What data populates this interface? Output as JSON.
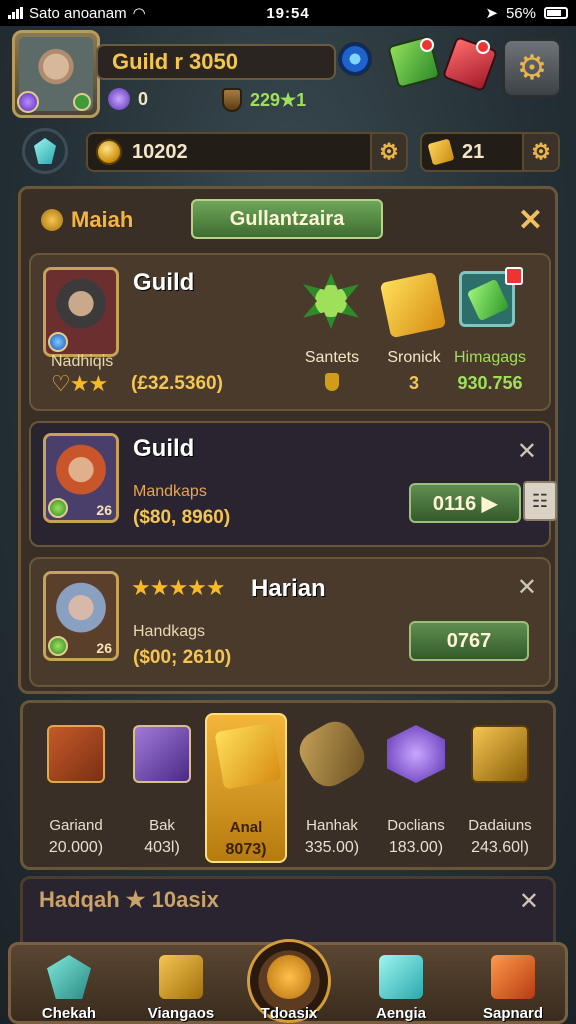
{
  "status": {
    "carrier": "Sato anoanam",
    "time": "19:54",
    "battery": "56%"
  },
  "header": {
    "title": "Guild r 3050",
    "purple_count": "0",
    "green_count": "229★1"
  },
  "resources": {
    "coins": "10202",
    "gold": "21"
  },
  "panel": {
    "title": "Maiah",
    "tab": "Gullantzaira",
    "card1": {
      "name": "Guild",
      "subtitle": "Nadhiqis",
      "amount": "(£32.5360)",
      "items": [
        {
          "label": "Santets",
          "value": ""
        },
        {
          "label": "Sronick",
          "value": "3"
        },
        {
          "label": "Himagags",
          "value": "930.756"
        }
      ]
    },
    "card2": {
      "name": "Guild",
      "subtitle": "Mandkaps",
      "amount": "($80, 8960)",
      "level": "26",
      "button": "0116 ▶"
    },
    "card3": {
      "name": "Harian",
      "subtitle": "Handkags",
      "amount": "($00; 2610)",
      "level": "26",
      "button": "0767"
    }
  },
  "items": [
    {
      "label": "Gariand",
      "value": "20.000)"
    },
    {
      "label": "Bak",
      "value": "403l)"
    },
    {
      "label": "Anal",
      "value": "8073)"
    },
    {
      "label": "Hanhak",
      "value": "335.00)"
    },
    {
      "label": "Doclians",
      "value": "183.00)"
    },
    {
      "label": "Dadaiuns",
      "value": "243.60l)"
    }
  ],
  "footer": {
    "title": "Hadqah ★ 10asix"
  },
  "nav": [
    {
      "label": "Chekah"
    },
    {
      "label": "Viangaos"
    },
    {
      "label": "Tdoasix"
    },
    {
      "label": "Aengia"
    },
    {
      "label": "Sapnard"
    }
  ]
}
